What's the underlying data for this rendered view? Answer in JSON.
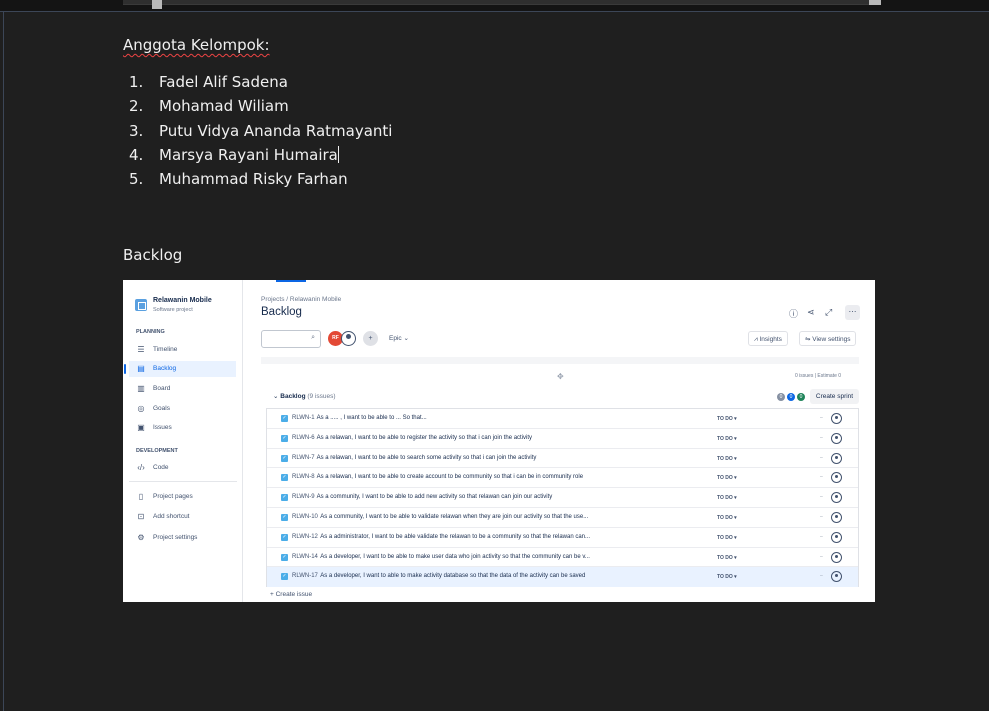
{
  "document": {
    "group_heading": "Anggota Kelompok:",
    "members": [
      {
        "num": "1.",
        "name": "Fadel Alif Sadena"
      },
      {
        "num": "2.",
        "name": "Mohamad Wiliam"
      },
      {
        "num": "3.",
        "name": "Putu Vidya Ananda Ratmayanti"
      },
      {
        "num": "4.",
        "name": "Marsya Rayani Humaira"
      },
      {
        "num": "5.",
        "name": "Muhammad Risky Farhan"
      }
    ],
    "backlog_heading": "Backlog"
  },
  "jira": {
    "project_name": "Relawanin Mobile",
    "project_type": "Software project",
    "sections": {
      "planning": "PLANNING",
      "development": "DEVELOPMENT"
    },
    "nav": {
      "timeline": "Timeline",
      "backlog": "Backlog",
      "board": "Board",
      "goals": "Goals",
      "issues": "Issues",
      "code": "Code",
      "project_pages": "Project pages",
      "add_shortcut": "Add shortcut",
      "project_settings": "Project settings"
    },
    "breadcrumb": "Projects  /  Relawanin Mobile",
    "title": "Backlog",
    "avatar_initials": "RF",
    "epic_label": "Epic",
    "insights_label": "Insights",
    "view_settings_label": "View settings",
    "sprint_meta": "0 issues  |  Estimate 0",
    "backlog_label": "Backlog",
    "backlog_count": "(9 issues)",
    "badges": [
      "0",
      "0",
      "0"
    ],
    "create_sprint": "Create sprint",
    "create_issue": "+ Create issue",
    "status_label": "TO DO ▾",
    "issues": [
      {
        "key": "RLWN-1",
        "summary": "As a ..... , I want to be able to ... So that..."
      },
      {
        "key": "RLWN-6",
        "summary": "As a relawan, I want to be able to register the activity so that i can join the activity"
      },
      {
        "key": "RLWN-7",
        "summary": "As a relawan, I want to be able to search some activity so that i can join the activity"
      },
      {
        "key": "RLWN-8",
        "summary": "As a relawan, I want to be able to create account to be community so that i can be in community role"
      },
      {
        "key": "RLWN-9",
        "summary": "As a community, I want to be able to add new activity so that relawan can join our activity"
      },
      {
        "key": "RLWN-10",
        "summary": "As a community, I want to be able to validate relawan when they are join our activity so that the use..."
      },
      {
        "key": "RLWN-12",
        "summary": "As a administrator, I want to be able validate the relawan to be a community so that the relawan can..."
      },
      {
        "key": "RLWN-14",
        "summary": "As a developer, I want to be able to make user data who join activity so that the community can be v..."
      },
      {
        "key": "RLWN-17",
        "summary": "As a developer, I want to able to make activity database so that the data of the activity can be saved"
      }
    ]
  }
}
